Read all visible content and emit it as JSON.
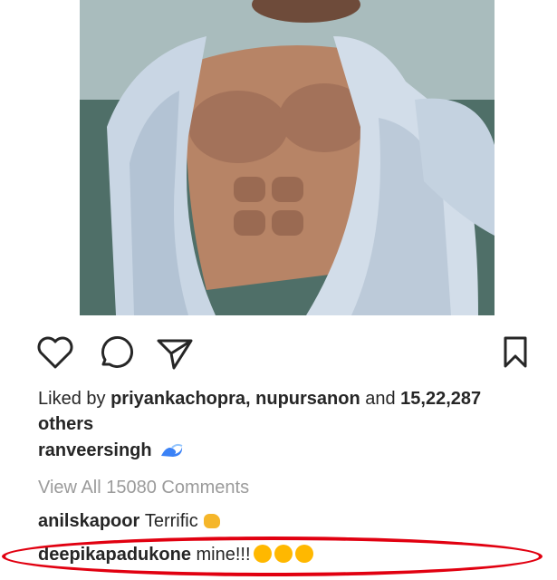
{
  "post": {
    "likes": {
      "prefix": "Liked by ",
      "user1": "priyankachopra",
      "sep": ", ",
      "user2": "nupursanon",
      "mid": " and ",
      "count": "15,22,287",
      "suffix": " others"
    },
    "caption": {
      "username": "ranveersingh",
      "emoji_icon": "wave-icon"
    },
    "view_all": "View All 15080 Comments",
    "comments": [
      {
        "username": "anilskapoor",
        "text": "Terrific"
      },
      {
        "username": "deepikapadukone",
        "text": "mine!!!"
      }
    ]
  },
  "colors": {
    "highlight": "#e10010",
    "muted_text": "#9b9b9b",
    "text": "#262626"
  }
}
